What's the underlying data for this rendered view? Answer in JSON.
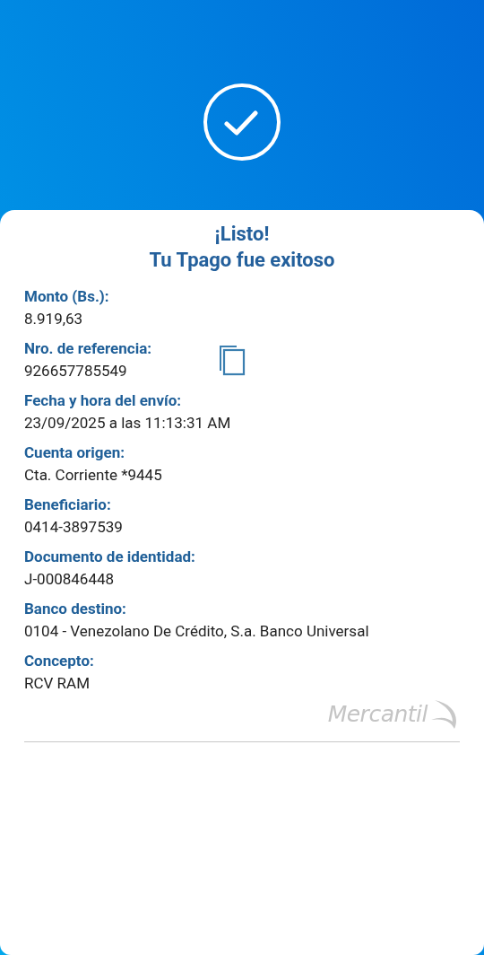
{
  "title_lines": [
    "¡Listo!",
    "Tu Tpago fue exitoso"
  ],
  "fields": [
    {
      "kind": "plain",
      "label": "Monto (Bs.):",
      "value": "8.919,63"
    },
    {
      "kind": "copyable",
      "label": "Nro. de referencia:",
      "value": "926657785549"
    },
    {
      "kind": "plain",
      "label": "Fecha y hora del envío:",
      "value": "23/09/2025 a las 11:13:31 AM"
    },
    {
      "kind": "plain",
      "label": "Cuenta origen:",
      "value": "Cta. Corriente *9445"
    },
    {
      "kind": "plain",
      "label": "Beneficiario:",
      "value": "0414-3897539"
    },
    {
      "kind": "plain",
      "label": "Documento de identidad:",
      "value": "J-000846448"
    },
    {
      "kind": "plain",
      "label": "Banco destino:",
      "value": "0104 - Venezolano De Crédito, S.a. Banco Universal"
    },
    {
      "kind": "plain",
      "label": "Concepto:",
      "value": "RCV RAM"
    }
  ],
  "brand": {
    "name": "Mercantil"
  }
}
